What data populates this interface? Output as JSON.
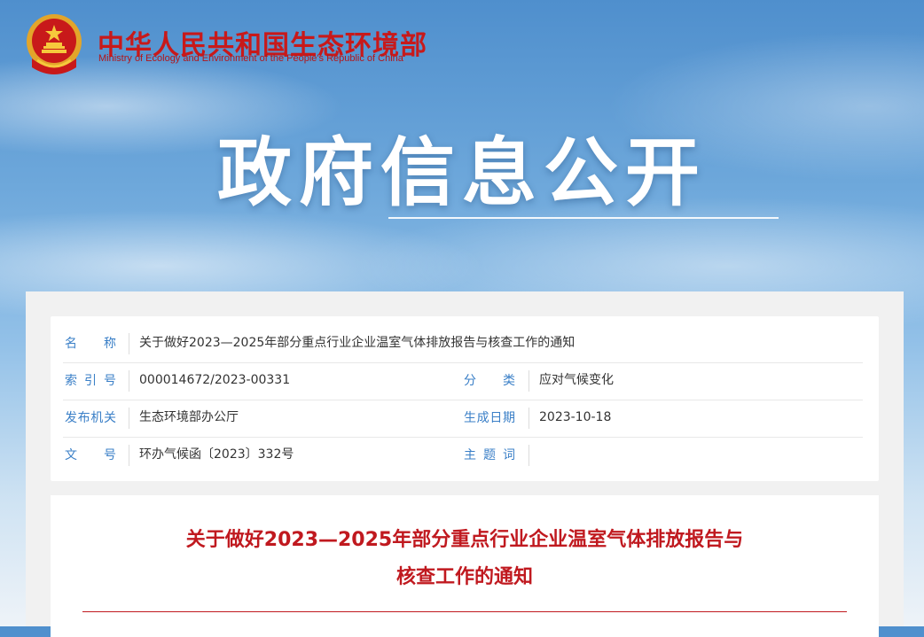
{
  "header": {
    "site_name_cn": "中华人民共和国生态环境部",
    "site_name_en": "Ministry of Ecology and Environment of the People's Republic of China",
    "emblem_icon": "national-emblem-icon",
    "banner_title": "政府信息公开"
  },
  "meta": {
    "name_label": "名　　称",
    "name_value": "关于做好2023—2025年部分重点行业企业温室气体排放报告与核查工作的通知",
    "index_label": "索 引 号",
    "index_value": "000014672/2023-00331",
    "category_label": "分　　类",
    "category_value": "应对气候变化",
    "issuer_label": "发布机关",
    "issuer_value": "生态环境部办公厅",
    "date_label": "生成日期",
    "date_value": "2023-10-18",
    "doc_no_label": "文　　号",
    "doc_no_value": "环办气候函〔2023〕332号",
    "subject_label": "主 题 词",
    "subject_value": ""
  },
  "article": {
    "title_line1": "关于做好2023—2025年部分重点行业企业温室气体排放报告与",
    "title_line2": "核查工作的通知"
  },
  "colors": {
    "brand_red": "#c8191a",
    "label_blue": "#3a7fc7",
    "title_red": "#c0191f"
  }
}
